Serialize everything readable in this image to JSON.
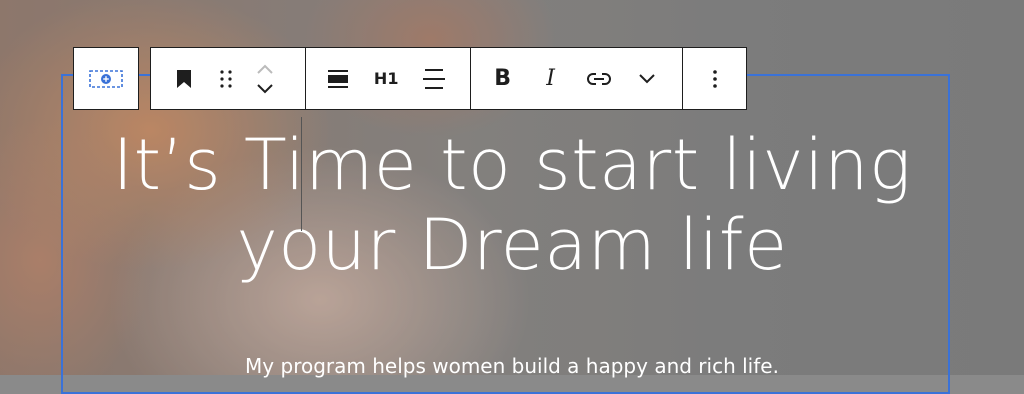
{
  "toolbar": {
    "parent_block": {
      "icon": "group-block-icon"
    },
    "group1": {
      "bookmark": "bookmark-icon",
      "drag": "drag-handle-icon",
      "move_up": "chevron-up-icon",
      "move_down": "chevron-down-icon"
    },
    "group2": {
      "align": "align-icon",
      "heading_level_label": "H1",
      "text_align": "text-align-icon"
    },
    "group3": {
      "bold_label": "B",
      "italic_label": "I",
      "link": "link-icon",
      "more": "chevron-down-icon"
    },
    "options": {
      "icon": "more-vertical-icon"
    }
  },
  "content": {
    "heading": "It’s Time to start living your Dream life",
    "subtext": "My program helps women build a happy and rich life."
  },
  "colors": {
    "selection_outline": "#3a72d8",
    "toolbar_bg": "#ffffff",
    "toolbar_border": "#1e1e1e",
    "heading_text": "#ffffff"
  }
}
